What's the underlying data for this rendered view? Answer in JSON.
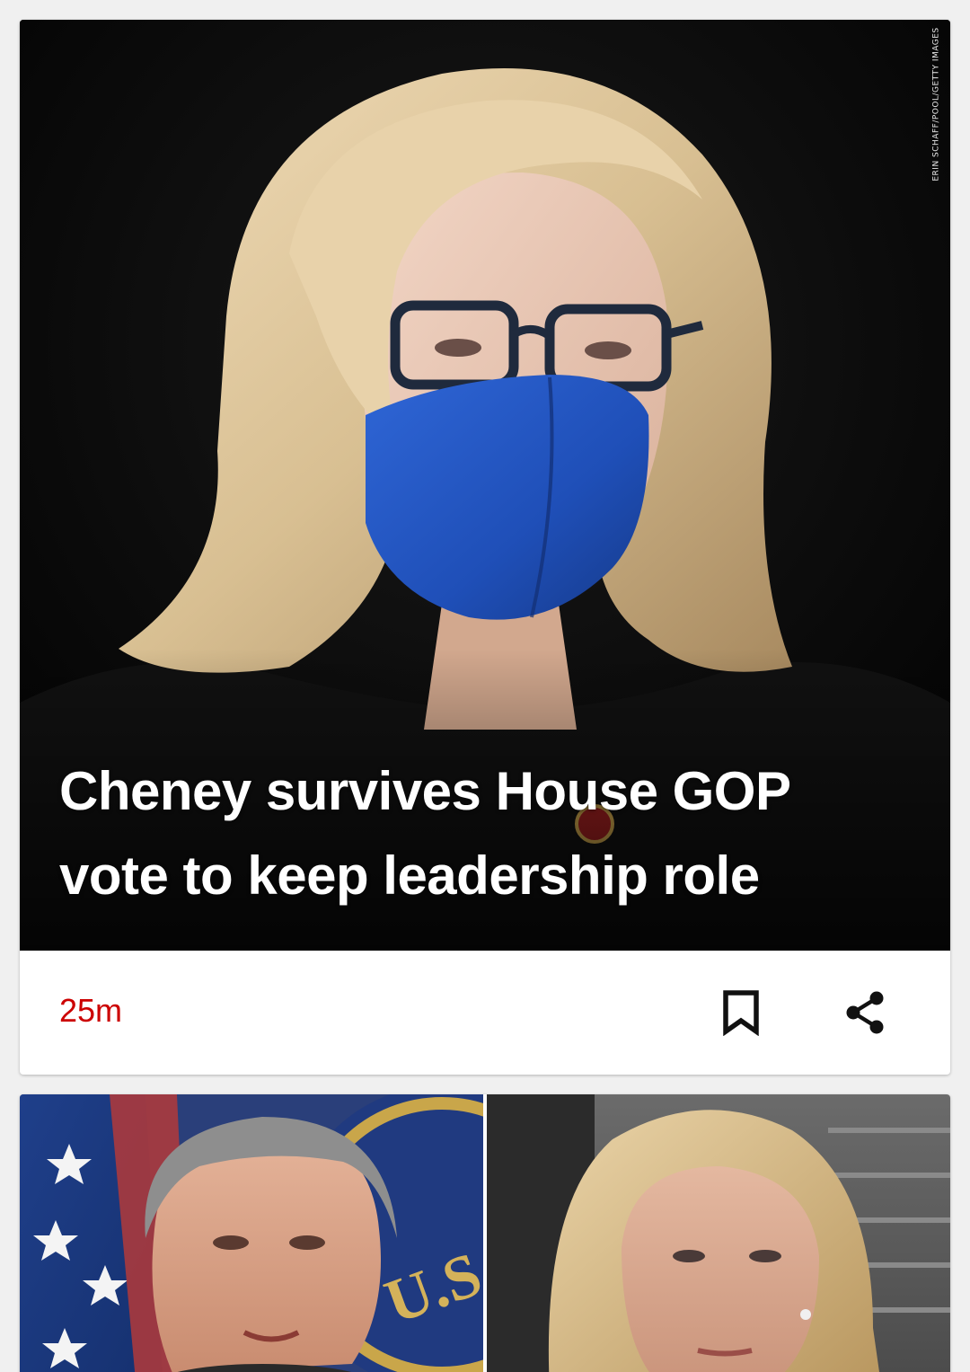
{
  "feed": {
    "top_story": {
      "headline": "Cheney survives House GOP vote to keep leadership role",
      "photo_credit": "ERIN SCHAFF/POOL/GETTY IMAGES",
      "image_icon": "photo-woman-blue-mask",
      "timestamp": "25m",
      "timestamp_color": "#cc0000",
      "bookmark_icon": "bookmark-icon",
      "share_icon": "share-icon"
    },
    "next_story": {
      "left_image_icon": "photo-man-gray-hair-flag",
      "right_image_icon": "photo-woman-blonde"
    }
  }
}
